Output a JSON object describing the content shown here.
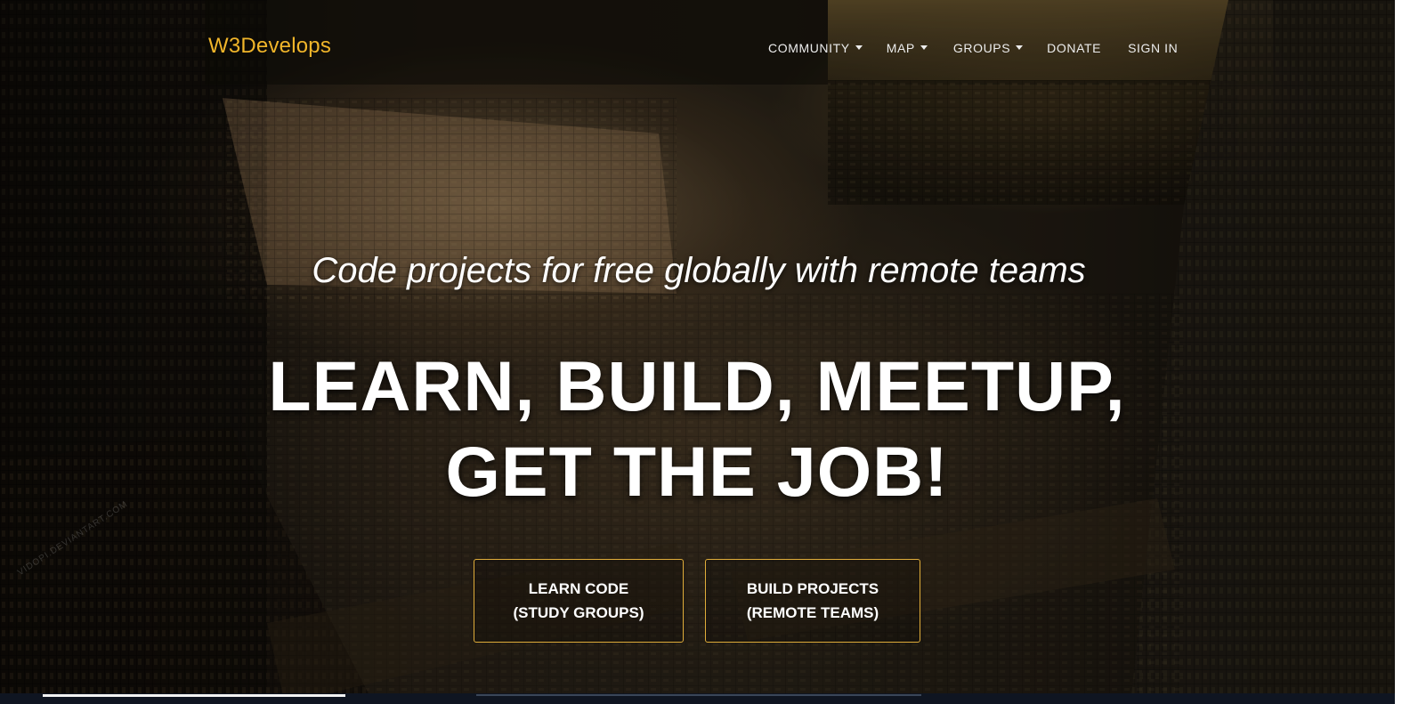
{
  "navbar": {
    "brand": "W3Develops",
    "items": [
      {
        "label": "COMMUNITY",
        "dropdown": true
      },
      {
        "label": "MAP",
        "dropdown": true
      },
      {
        "label": "GROUPS",
        "dropdown": true
      },
      {
        "label": "DONATE",
        "dropdown": false
      },
      {
        "label": "SIGN IN",
        "dropdown": false
      }
    ]
  },
  "hero": {
    "subtitle": "Code projects for free globally with remote teams",
    "headline_line1": "LEARN, BUILD, MEETUP,",
    "headline_line2": "GET THE JOB!",
    "buttons": [
      {
        "line1": "LEARN CODE",
        "line2": "(STUDY GROUPS)"
      },
      {
        "line1": "BUILD PROJECTS",
        "line2": "(REMOTE TEAMS)"
      }
    ],
    "watermark": "VIDOPI.DEVIANTART.COM"
  },
  "colors": {
    "brand": "#f0b52a",
    "button_border": "#e0ad3a",
    "text": "#ffffff"
  }
}
